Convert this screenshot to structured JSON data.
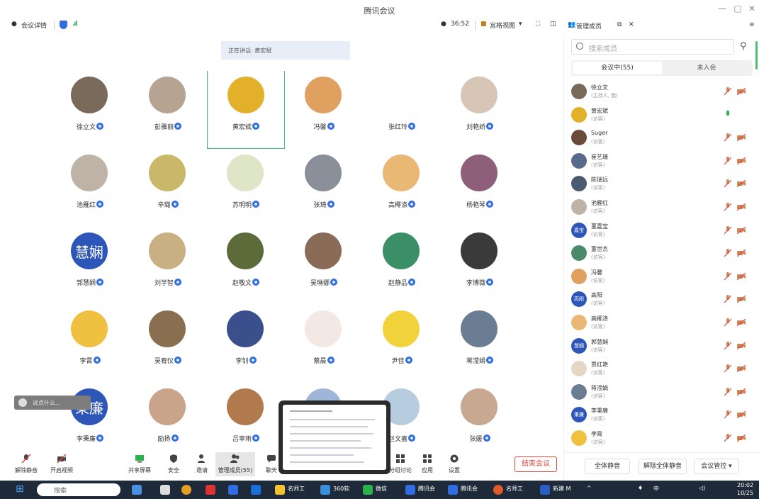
{
  "window": {
    "title": "腾讯会议",
    "controls": [
      "—",
      "▢",
      "✕"
    ]
  },
  "infobar": {
    "meeting_details": "会议详情",
    "timer": "36:52",
    "view_mode": "宫格视图",
    "members_tab": "管理成员"
  },
  "speaking": "正在讲话: 黄宏斌",
  "grid": [
    {
      "name": "徐立文",
      "bg": "#7a6a5a"
    },
    {
      "name": "彭雅丽",
      "bg": "#b7a391"
    },
    {
      "name": "黄宏斌",
      "bg": "#e3b02a",
      "active": true
    },
    {
      "name": "冯馨",
      "bg": "#e0a060"
    },
    {
      "name": "张红玲",
      "bg": "#ffffff"
    },
    {
      "name": "刘艳娇",
      "bg": "#d7c6b6"
    },
    {
      "name": "池雁红",
      "bg": "#bfb2a6"
    },
    {
      "name": "辛璐",
      "bg": "#c9b86a"
    },
    {
      "name": "苏明明",
      "bg": "#dfe6c8"
    },
    {
      "name": "张琦",
      "bg": "#8a8f9a"
    },
    {
      "name": "高椰涤",
      "bg": "#e9b874"
    },
    {
      "name": "杨艳琴",
      "bg": "#8d5f7b"
    },
    {
      "name": "郭慧娴",
      "bg": "#2e56b8",
      "text": "慧娴"
    },
    {
      "name": "刘学智",
      "bg": "#c8b083"
    },
    {
      "name": "赵敬文",
      "bg": "#5d6b3a"
    },
    {
      "name": "吴琳娜",
      "bg": "#8a6b58"
    },
    {
      "name": "赵静品",
      "bg": "#3a8f66"
    },
    {
      "name": "李博薇",
      "bg": "#3a3a3a"
    },
    {
      "name": "李霄",
      "bg": "#f0c040"
    },
    {
      "name": "吴宥仪",
      "bg": "#8a6e50"
    },
    {
      "name": "李钊",
      "bg": "#3b4f8c"
    },
    {
      "name": "蔡晨",
      "bg": "#f4e8e4"
    },
    {
      "name": "尹佳",
      "bg": "#f2d23a"
    },
    {
      "name": "蒋滢娟",
      "bg": "#6a7d92"
    },
    {
      "name": "李秉廉",
      "bg": "#2e56b8",
      "text": "秉廉"
    },
    {
      "name": "励扬",
      "bg": "#c9a48a"
    },
    {
      "name": "吕宰雨",
      "bg": "#b07a4c"
    },
    {
      "name": "",
      "bg": "#9fb6d8"
    },
    {
      "name": "赵文嘉",
      "bg": "#b8cce0"
    },
    {
      "name": "张媛",
      "bg": "#c8a890"
    }
  ],
  "chat_placeholder": "说点什么...",
  "toolbar": {
    "unmute": "解除静音",
    "video": "开启视频",
    "share": "共享屏幕",
    "security": "安全",
    "invite": "邀请",
    "members": "管理成员(55)",
    "chat": "聊天",
    "breakout": "分组讨论",
    "apps": "应用",
    "settings": "设置",
    "end": "结束会议"
  },
  "panel": {
    "search_placeholder": "搜索成员",
    "tab_in": "会议中(55)",
    "tab_out": "未入会",
    "members": [
      {
        "name": "徐立文",
        "role": "(主持人, 我)",
        "bg": "#7a6a5a",
        "mic": "off"
      },
      {
        "name": "黄宏斌",
        "role": "(访客)",
        "bg": "#e3b02a",
        "mic": "on"
      },
      {
        "name": "Suger",
        "role": "(访客)",
        "bg": "#6b4a3a",
        "mic": "off"
      },
      {
        "name": "崔艺珊",
        "role": "(访客)",
        "bg": "#5a6a8a",
        "mic": "off"
      },
      {
        "name": "陈瑞远",
        "role": "(访客)",
        "bg": "#4a5a70",
        "mic": "off"
      },
      {
        "name": "池雁红",
        "role": "(访客)",
        "bg": "#bfb2a6",
        "mic": "off"
      },
      {
        "name": "董嘉宝",
        "role": "(访客)",
        "bg": "#2e56b8",
        "text": "嘉宝",
        "mic": "off"
      },
      {
        "name": "董世杰",
        "role": "(访客)",
        "bg": "#4a8a6a",
        "mic": "off"
      },
      {
        "name": "冯馨",
        "role": "(访客)",
        "bg": "#e0a060",
        "mic": "off"
      },
      {
        "name": "高阳",
        "role": "(访客)",
        "bg": "#2e56b8",
        "text": "高阳",
        "mic": "off"
      },
      {
        "name": "高椰涤",
        "role": "(访客)",
        "bg": "#e9b874",
        "mic": "off"
      },
      {
        "name": "郭慧娴",
        "role": "(访客)",
        "bg": "#2e56b8",
        "text": "慧娴",
        "mic": "off"
      },
      {
        "name": "贾红艳",
        "role": "(访客)",
        "bg": "#e6d6c6",
        "mic": "off"
      },
      {
        "name": "蒋滢娟",
        "role": "(访客)",
        "bg": "#6a7d92",
        "mic": "off"
      },
      {
        "name": "李秉廉",
        "role": "(访客)",
        "bg": "#2e56b8",
        "text": "秉廉",
        "mic": "off"
      },
      {
        "name": "李霄",
        "role": "(访客)",
        "bg": "#f0c040",
        "mic": "off"
      }
    ],
    "mute_all": "全体静音",
    "unmute_all": "解除全体静音",
    "control": "会议管控 ▾"
  },
  "taskbar": {
    "search": "搜索",
    "items": [
      "名师工",
      "360软",
      "微信",
      "腾讯会",
      "腾讯会",
      "名师工",
      "新建 M"
    ],
    "ime": "中",
    "time": "20:02",
    "date": "10/25"
  },
  "colors": {
    "accent": "#2f6de1",
    "end": "#e0453a",
    "active": "#3cc07f"
  }
}
